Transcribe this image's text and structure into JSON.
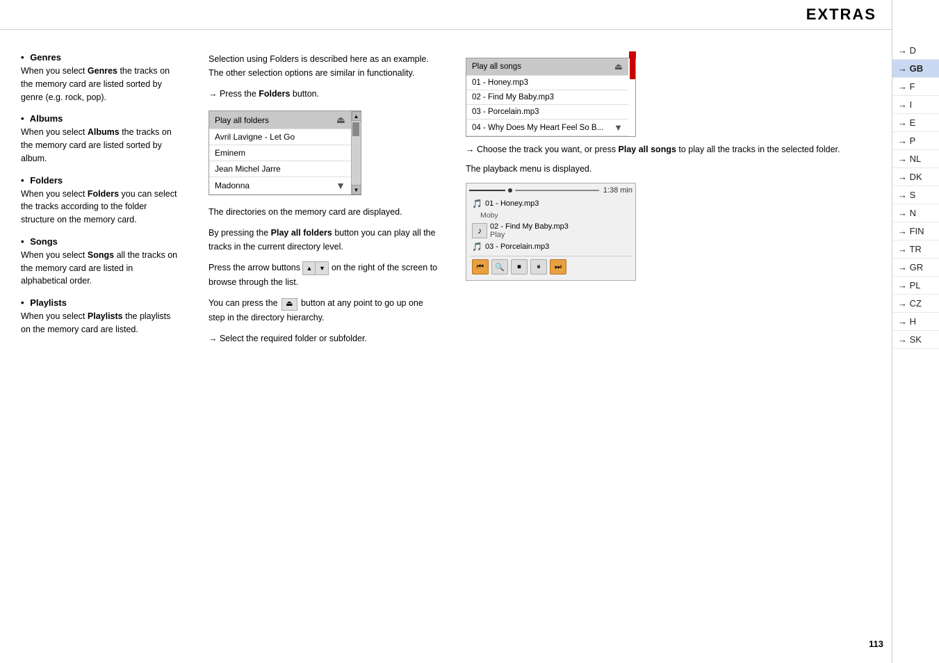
{
  "header": {
    "title": "EXTRAS",
    "arrows": "→→→"
  },
  "page_number": "113",
  "right_sidebar": {
    "items": [
      {
        "label": "→ D",
        "highlight": false
      },
      {
        "label": "→ GB",
        "highlight": true
      },
      {
        "label": "→ F",
        "highlight": false
      },
      {
        "label": "→ I",
        "highlight": false
      },
      {
        "label": "→ E",
        "highlight": false
      },
      {
        "label": "→ P",
        "highlight": false
      },
      {
        "label": "→ NL",
        "highlight": false
      },
      {
        "label": "→ DK",
        "highlight": false
      },
      {
        "label": "→ S",
        "highlight": false
      },
      {
        "label": "→ N",
        "highlight": false
      },
      {
        "label": "→ FIN",
        "highlight": false
      },
      {
        "label": "→ TR",
        "highlight": false
      },
      {
        "label": "→ GR",
        "highlight": false
      },
      {
        "label": "→ PL",
        "highlight": false
      },
      {
        "label": "→ CZ",
        "highlight": false
      },
      {
        "label": "→ H",
        "highlight": false
      },
      {
        "label": "→ SK",
        "highlight": false
      }
    ]
  },
  "left_column": {
    "sections": [
      {
        "id": "genres",
        "title": "Genres",
        "body": "When you select Genres the tracks on the memory card are listed sorted by genre (e.g. rock, pop).",
        "bold_word": "Genres"
      },
      {
        "id": "albums",
        "title": "Albums",
        "body": "When you select Albums the tracks on the memory card are listed sorted by album.",
        "bold_word": "Albums"
      },
      {
        "id": "folders",
        "title": "Folders",
        "body": "When you select Folders you can select the tracks according to the folder structure on the memory card.",
        "bold_word": "Folders"
      },
      {
        "id": "songs",
        "title": "Songs",
        "body": "When you select Songs all the tracks on the memory card are listed in alphabetical order.",
        "bold_word": "Songs"
      },
      {
        "id": "playlists",
        "title": "Playlists",
        "body": "When you select Playlists the playlists on the memory card are listed.",
        "bold_word": "Playlists"
      }
    ]
  },
  "middle_column": {
    "intro": "Selection using Folders is described here as an example. The other selection options are similar in functionality.",
    "step1": "→ Press the Folders button.",
    "folder_list": {
      "rows": [
        {
          "text": "Play all folders",
          "icon": "⏏",
          "is_header": true
        },
        {
          "text": "Avril Lavigne - Let Go",
          "icon": ""
        },
        {
          "text": "Eminem",
          "icon": ""
        },
        {
          "text": "Jean Michel Jarre",
          "icon": ""
        },
        {
          "text": "Madonna",
          "icon": "",
          "is_last": true
        }
      ]
    },
    "para1": "The directories on the memory card are displayed.",
    "para2": "By pressing the Play all folders button you can play all the tracks in the current directory level.",
    "para3_prefix": "Press the arrow buttons",
    "para3_mid": "on the right of the screen to browse through the list.",
    "para4_prefix": "You can press the",
    "para4_mid": "button at any point to go up one step in the directory hierarchy.",
    "step2": "→ Select the required folder or subfolder."
  },
  "right_column": {
    "song_list": {
      "rows": [
        {
          "text": "Play all songs",
          "icon": "⏏",
          "is_header": true
        },
        {
          "text": "01 - Honey.mp3",
          "icon": ""
        },
        {
          "text": "02 - Find My Baby.mp3",
          "icon": ""
        },
        {
          "text": "03 - Porcelain.mp3",
          "icon": ""
        },
        {
          "text": "04 - Why Does My Heart Feel So B...",
          "icon": "▼",
          "is_last": true
        }
      ]
    },
    "step1": "→ Choose the track you want, or press Play all songs to play all the tracks in the selected folder.",
    "step2_text": "The playback menu is displayed.",
    "playback": {
      "progress_time": "1:38 min",
      "track1": "01 - Honey.mp3",
      "track1_artist": "Moby",
      "track1_sub": "02 - Find My Baby.mp3",
      "track1_sub2": "Play",
      "track2": "03 - Porcelain.mp3"
    }
  }
}
